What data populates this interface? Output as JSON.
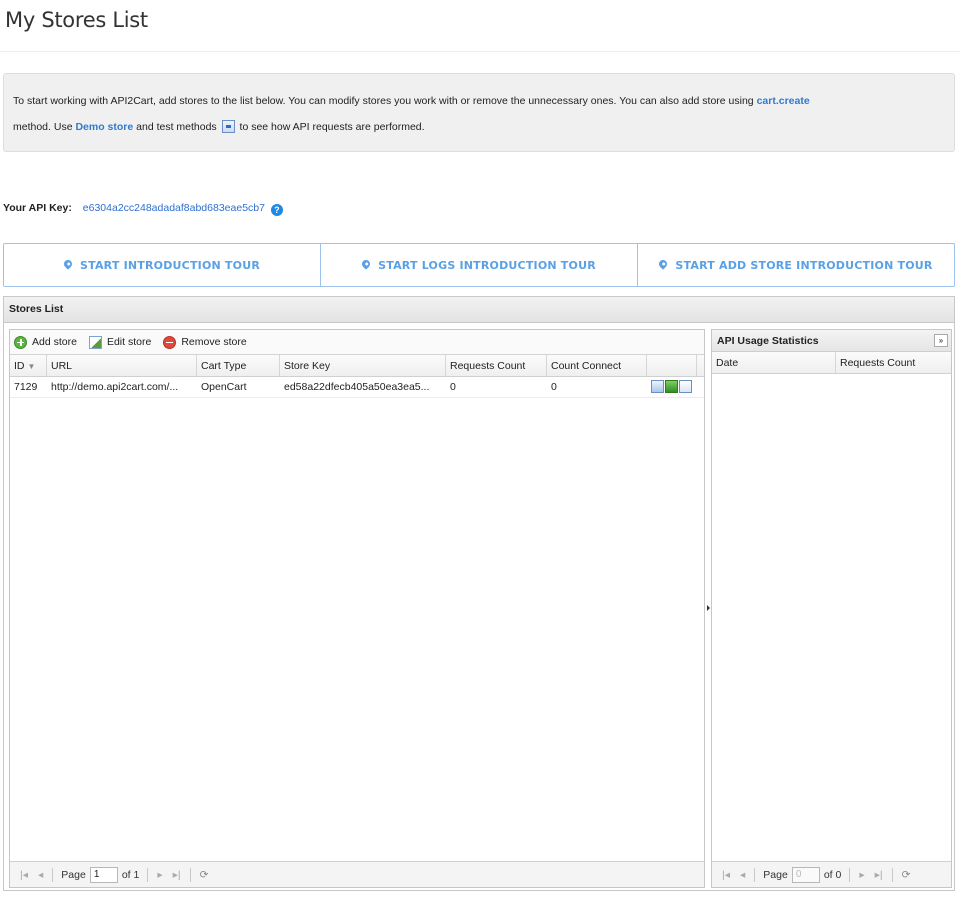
{
  "page": {
    "title": "My Stores List"
  },
  "info": {
    "text1": "To start working with API2Cart, add stores to the list below. You can modify stores you work with or remove the unnecessary ones. You can also add store using ",
    "link_cart_create": "cart.create",
    "text2": "method. Use ",
    "link_demo": "Demo store",
    "text3": " and test methods ",
    "text4": " to see how API requests are performed."
  },
  "api_key": {
    "label": "Your API Key:",
    "value": "e6304a2cc248adadaf8abd683eae5cb7",
    "help": "?"
  },
  "tours": [
    {
      "label": "START INTRODUCTION TOUR"
    },
    {
      "label": "START LOGS INTRODUCTION TOUR"
    },
    {
      "label": "START ADD STORE INTRODUCTION TOUR"
    }
  ],
  "stores_panel": {
    "title": "Stores List",
    "toolbar": {
      "add": "Add store",
      "edit": "Edit store",
      "remove": "Remove store"
    },
    "columns": [
      "ID",
      "URL",
      "Cart Type",
      "Store Key",
      "Requests Count",
      "Count Connect",
      ""
    ],
    "rows": [
      {
        "id": "7129",
        "url": "http://demo.api2cart.com/...",
        "cart_type": "OpenCart",
        "store_key": "ed58a22dfecb405a50ea3ea5...",
        "requests": "0",
        "connect": "0"
      }
    ],
    "pager": {
      "page_label": "Page",
      "page_value": "1",
      "of_label": "of 1"
    }
  },
  "usage_panel": {
    "title": "API Usage Statistics",
    "collapse": "»",
    "columns": [
      "Date",
      "Requests Count"
    ],
    "pager": {
      "page_label": "Page",
      "page_value": "0",
      "of_label": "of 0"
    }
  }
}
